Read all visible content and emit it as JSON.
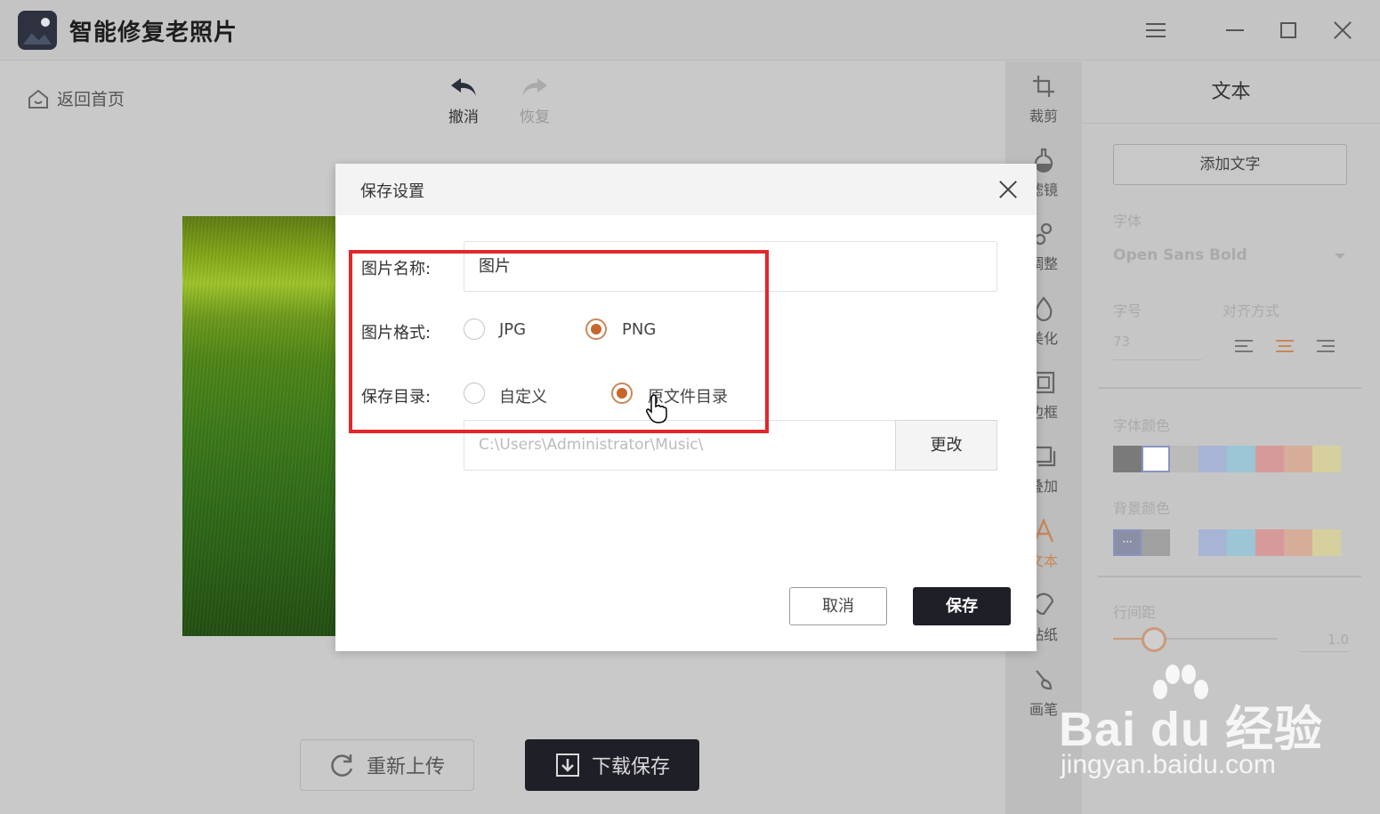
{
  "app": {
    "title": "智能修复老照片"
  },
  "toolbar": {
    "home_label": "返回首页",
    "undo_label": "撤消",
    "redo_label": "恢复"
  },
  "bottom": {
    "reupload_label": "重新上传",
    "download_label": "下载保存"
  },
  "tools": [
    {
      "label": "裁剪",
      "icon": "crop-icon"
    },
    {
      "label": "滤镜",
      "icon": "filter-icon"
    },
    {
      "label": "调整",
      "icon": "adjust-icon"
    },
    {
      "label": "美化",
      "icon": "beautify-icon"
    },
    {
      "label": "边框",
      "icon": "frame-icon"
    },
    {
      "label": "叠加",
      "icon": "overlay-icon"
    },
    {
      "label": "文本",
      "icon": "text-icon",
      "active": true
    },
    {
      "label": "贴纸",
      "icon": "sticker-icon"
    },
    {
      "label": "画笔",
      "icon": "brush-icon"
    }
  ],
  "panel": {
    "title": "文本",
    "add_text_label": "添加文字",
    "font_label": "字体",
    "font_value": "Open Sans Bold",
    "size_label": "字号",
    "size_value": "73",
    "align_label": "对齐方式",
    "font_color_label": "字体颜色",
    "bg_color_label": "背景颜色",
    "line_spacing_label": "行间距",
    "line_spacing_value": "1.0",
    "font_colors": [
      "#7a7a7a",
      "#ffffff",
      "#bbbbbb",
      "#a7b4d6",
      "#9cc6d6",
      "#d69a9a",
      "#d6ad98",
      "#d6d09e"
    ],
    "bg_colors": [
      "#8a8fa6",
      "#a0a0a0",
      "#c6c6c6",
      "#a7b4d6",
      "#9cc6d6",
      "#d69a9a",
      "#d6ad98",
      "#d6d09e"
    ]
  },
  "dialog": {
    "title": "保存设置",
    "name_label": "图片名称:",
    "name_value": "图片",
    "format_label": "图片格式:",
    "format_options": [
      "JPG",
      "PNG"
    ],
    "format_selected": "PNG",
    "dir_label": "保存目录:",
    "dir_options": [
      "自定义",
      "原文件目录"
    ],
    "dir_selected": "原文件目录",
    "path_value": "C:\\Users\\Administrator\\Music\\",
    "change_label": "更改",
    "cancel_label": "取消",
    "save_label": "保存"
  },
  "watermark": {
    "brand": "Bai du 经验",
    "url": "jingyan.baidu.com"
  },
  "colors": {
    "accent": "#c9652b",
    "highlight": "#e3262b",
    "dark_button": "#1f1f28"
  }
}
